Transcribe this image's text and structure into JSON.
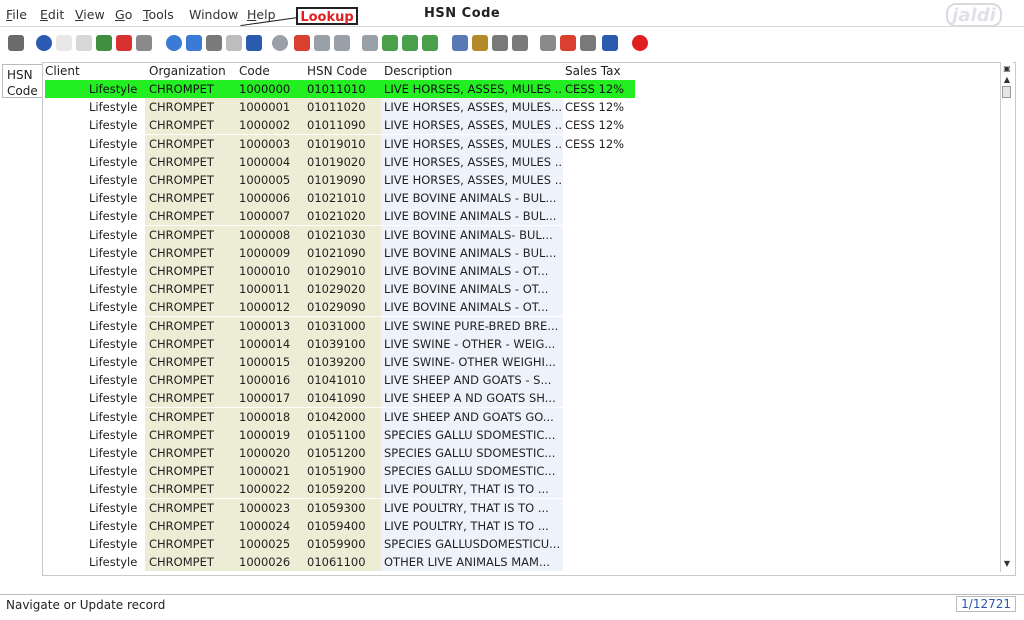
{
  "menu": [
    {
      "label": "File",
      "underline": "F",
      "rest": "ile"
    },
    {
      "label": "Edit",
      "underline": "E",
      "rest": "dit"
    },
    {
      "label": "View",
      "underline": "V",
      "rest": "iew"
    },
    {
      "label": "Go",
      "underline": "G",
      "rest": "o"
    },
    {
      "label": "Tools",
      "underline": "T",
      "rest": "ools"
    },
    {
      "label": "Window",
      "underline": "",
      "rest": "Window"
    },
    {
      "label": "Help",
      "underline": "H",
      "rest": "elp"
    }
  ],
  "window_title": "HSN Code",
  "callout": "Lookup",
  "logo_text": "jaldi",
  "toolbar_icons": [
    {
      "name": "undo-icon",
      "color": "#6b6b6b"
    },
    {
      "name": "help-icon",
      "color": "#2a5bb0"
    },
    {
      "name": "new-record-icon",
      "color": "#e8e8e8"
    },
    {
      "name": "copy-record-icon",
      "color": "#d8d8d8"
    },
    {
      "name": "save-icon",
      "color": "#3f8f3f"
    },
    {
      "name": "delete-icon",
      "color": "#d93030"
    },
    {
      "name": "delete-selection-icon",
      "color": "#8a8a8a"
    },
    {
      "name": "refresh-icon",
      "color": "#3a7bd5"
    },
    {
      "name": "lookup-icon",
      "color": "#3a7bd5"
    },
    {
      "name": "attachment-icon",
      "color": "#7a7a7a"
    },
    {
      "name": "chat-icon",
      "color": "#bdbdbd"
    },
    {
      "name": "grid-toggle-icon",
      "color": "#2a5bb0"
    },
    {
      "name": "history-icon",
      "color": "#9aa0a8"
    },
    {
      "name": "home-icon",
      "color": "#d94030"
    },
    {
      "name": "parent-record-icon",
      "color": "#9aa0a8"
    },
    {
      "name": "detail-record-icon",
      "color": "#9aa0a8"
    },
    {
      "name": "first-record-icon",
      "color": "#9aa0a8"
    },
    {
      "name": "previous-record-icon",
      "color": "#4aa04a"
    },
    {
      "name": "next-record-icon",
      "color": "#4aa04a"
    },
    {
      "name": "last-record-icon",
      "color": "#4aa04a"
    },
    {
      "name": "report-icon",
      "color": "#5a7ab5"
    },
    {
      "name": "archive-icon",
      "color": "#b58a2a"
    },
    {
      "name": "print-preview-icon",
      "color": "#7a7a7a"
    },
    {
      "name": "print-icon",
      "color": "#7a7a7a"
    },
    {
      "name": "zoom-across-icon",
      "color": "#8a8a8a"
    },
    {
      "name": "workflow-icon",
      "color": "#d94030"
    },
    {
      "name": "product-info-icon",
      "color": "#7a7a7a"
    },
    {
      "name": "request-icon",
      "color": "#2a5bb0"
    },
    {
      "name": "close-window-icon",
      "color": "#e02020"
    }
  ],
  "side_tab": {
    "line1": "HSN",
    "line2": "Code"
  },
  "columns": {
    "client": "Client",
    "organization": "Organization",
    "code": "Code",
    "hsn_code": "HSN Code",
    "description": "Description",
    "sales_tax": "Sales Tax"
  },
  "rows": [
    {
      "client": "Lifestyle",
      "org": "CHROMPET",
      "code": "1000000",
      "hsn": "01011010",
      "desc": "LIVE HORSES, ASSES, MULES ...",
      "tax": "CESS 12%",
      "selected": true
    },
    {
      "client": "Lifestyle",
      "org": "CHROMPET",
      "code": "1000001",
      "hsn": "01011020",
      "desc": "LIVE HORSES, ASSES, MULES...",
      "tax": "CESS 12%"
    },
    {
      "client": "Lifestyle",
      "org": "CHROMPET",
      "code": "1000002",
      "hsn": "01011090",
      "desc": "LIVE HORSES, ASSES, MULES ...",
      "tax": "CESS 12%"
    },
    {
      "client": "Lifestyle",
      "org": "CHROMPET",
      "code": "1000003",
      "hsn": "01019010",
      "desc": "LIVE HORSES, ASSES, MULES ...",
      "tax": "CESS 12%"
    },
    {
      "client": "Lifestyle",
      "org": "CHROMPET",
      "code": "1000004",
      "hsn": "01019020",
      "desc": "LIVE HORSES, ASSES, MULES ...",
      "tax": ""
    },
    {
      "client": "Lifestyle",
      "org": "CHROMPET",
      "code": "1000005",
      "hsn": "01019090",
      "desc": "LIVE HORSES, ASSES, MULES ...",
      "tax": ""
    },
    {
      "client": "Lifestyle",
      "org": "CHROMPET",
      "code": "1000006",
      "hsn": "01021010",
      "desc": "LIVE BOVINE ANIMALS - BUL...",
      "tax": ""
    },
    {
      "client": "Lifestyle",
      "org": "CHROMPET",
      "code": "1000007",
      "hsn": "01021020",
      "desc": "LIVE BOVINE ANIMALS - BUL...",
      "tax": ""
    },
    {
      "client": "Lifestyle",
      "org": "CHROMPET",
      "code": "1000008",
      "hsn": "01021030",
      "desc": "LIVE BOVINE ANIMALS- BUL...",
      "tax": ""
    },
    {
      "client": "Lifestyle",
      "org": "CHROMPET",
      "code": "1000009",
      "hsn": "01021090",
      "desc": "LIVE BOVINE ANIMALS - BUL...",
      "tax": ""
    },
    {
      "client": "Lifestyle",
      "org": "CHROMPET",
      "code": "1000010",
      "hsn": "01029010",
      "desc": "LIVE BOVINE ANIMALS - OT...",
      "tax": ""
    },
    {
      "client": "Lifestyle",
      "org": "CHROMPET",
      "code": "1000011",
      "hsn": "01029020",
      "desc": "LIVE BOVINE ANIMALS - OT...",
      "tax": ""
    },
    {
      "client": "Lifestyle",
      "org": "CHROMPET",
      "code": "1000012",
      "hsn": "01029090",
      "desc": "LIVE BOVINE ANIMALS - OT...",
      "tax": ""
    },
    {
      "client": "Lifestyle",
      "org": "CHROMPET",
      "code": "1000013",
      "hsn": "01031000",
      "desc": "LIVE SWINE PURE-BRED BRE...",
      "tax": ""
    },
    {
      "client": "Lifestyle",
      "org": "CHROMPET",
      "code": "1000014",
      "hsn": "01039100",
      "desc": "LIVE SWINE - OTHER - WEIG...",
      "tax": ""
    },
    {
      "client": "Lifestyle",
      "org": "CHROMPET",
      "code": "1000015",
      "hsn": "01039200",
      "desc": "LIVE SWINE- OTHER WEIGHI...",
      "tax": ""
    },
    {
      "client": "Lifestyle",
      "org": "CHROMPET",
      "code": "1000016",
      "hsn": "01041010",
      "desc": "LIVE SHEEP AND GOATS - S...",
      "tax": ""
    },
    {
      "client": "Lifestyle",
      "org": "CHROMPET",
      "code": "1000017",
      "hsn": "01041090",
      "desc": "LIVE SHEEP A ND GOATS SH...",
      "tax": ""
    },
    {
      "client": "Lifestyle",
      "org": "CHROMPET",
      "code": "1000018",
      "hsn": "01042000",
      "desc": "LIVE SHEEP AND GOATS GO...",
      "tax": ""
    },
    {
      "client": "Lifestyle",
      "org": "CHROMPET",
      "code": "1000019",
      "hsn": "01051100",
      "desc": "SPECIES GALLU SDOMESTIC...",
      "tax": ""
    },
    {
      "client": "Lifestyle",
      "org": "CHROMPET",
      "code": "1000020",
      "hsn": "01051200",
      "desc": "SPECIES GALLU SDOMESTIC...",
      "tax": ""
    },
    {
      "client": "Lifestyle",
      "org": "CHROMPET",
      "code": "1000021",
      "hsn": "01051900",
      "desc": "SPECIES GALLU SDOMESTIC...",
      "tax": ""
    },
    {
      "client": "Lifestyle",
      "org": "CHROMPET",
      "code": "1000022",
      "hsn": "01059200",
      "desc": "LIVE POULTRY, THAT IS TO ...",
      "tax": ""
    },
    {
      "client": "Lifestyle",
      "org": "CHROMPET",
      "code": "1000023",
      "hsn": "01059300",
      "desc": "LIVE POULTRY, THAT IS TO ...",
      "tax": ""
    },
    {
      "client": "Lifestyle",
      "org": "CHROMPET",
      "code": "1000024",
      "hsn": "01059400",
      "desc": "LIVE POULTRY, THAT IS TO ...",
      "tax": ""
    },
    {
      "client": "Lifestyle",
      "org": "CHROMPET",
      "code": "1000025",
      "hsn": "01059900",
      "desc": "SPECIES GALLUSDOMESTICU...",
      "tax": ""
    },
    {
      "client": "Lifestyle",
      "org": "CHROMPET",
      "code": "1000026",
      "hsn": "01061100",
      "desc": "OTHER LIVE ANIMALS MAM...",
      "tax": ""
    }
  ],
  "status": {
    "message": "Navigate or Update record",
    "record_count": "1/12721"
  }
}
